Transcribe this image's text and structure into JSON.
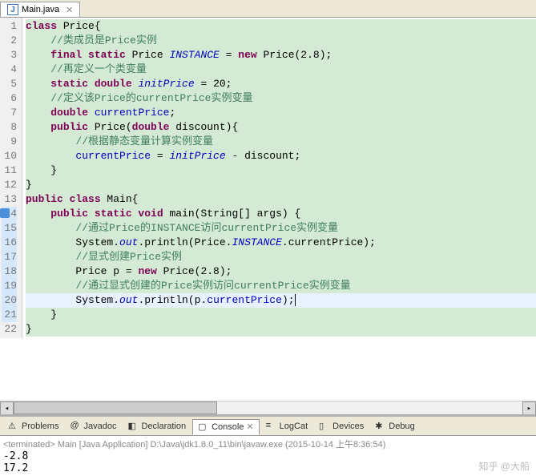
{
  "tab": {
    "title": "Main.java",
    "close": "✕"
  },
  "lines": [
    {
      "n": 1,
      "hl": false,
      "bg": "green",
      "tokens": [
        [
          "kw",
          "class"
        ],
        [
          "",
          " Price{"
        ]
      ]
    },
    {
      "n": 2,
      "hl": false,
      "bg": "green",
      "tokens": [
        [
          "",
          "    "
        ],
        [
          "cm",
          "//类成员是Price实例"
        ]
      ]
    },
    {
      "n": 3,
      "hl": false,
      "bg": "green",
      "tokens": [
        [
          "",
          "    "
        ],
        [
          "kw",
          "final static"
        ],
        [
          "",
          " Price "
        ],
        [
          "it",
          "INSTANCE"
        ],
        [
          "",
          " = "
        ],
        [
          "kw",
          "new"
        ],
        [
          "",
          " Price(2.8);"
        ]
      ]
    },
    {
      "n": 4,
      "hl": false,
      "bg": "green",
      "tokens": [
        [
          "",
          "    "
        ],
        [
          "cm",
          "//再定义一个类变量"
        ]
      ]
    },
    {
      "n": 5,
      "hl": false,
      "bg": "green",
      "tokens": [
        [
          "",
          "    "
        ],
        [
          "kw",
          "static double"
        ],
        [
          "",
          " "
        ],
        [
          "it",
          "initPrice"
        ],
        [
          "",
          " = 20;"
        ]
      ]
    },
    {
      "n": 6,
      "hl": false,
      "bg": "green",
      "tokens": [
        [
          "",
          "    "
        ],
        [
          "cm",
          "//定义该Price的currentPrice实例变量"
        ]
      ]
    },
    {
      "n": 7,
      "hl": false,
      "bg": "green",
      "tokens": [
        [
          "",
          "    "
        ],
        [
          "kw",
          "double"
        ],
        [
          "",
          " "
        ],
        [
          "fld",
          "currentPrice"
        ],
        [
          "",
          ";"
        ]
      ]
    },
    {
      "n": 8,
      "hl": false,
      "bg": "green",
      "tokens": [
        [
          "",
          "    "
        ],
        [
          "kw",
          "public"
        ],
        [
          "",
          " Price("
        ],
        [
          "kw",
          "double"
        ],
        [
          "",
          " discount){"
        ]
      ]
    },
    {
      "n": 9,
      "hl": false,
      "bg": "green",
      "tokens": [
        [
          "",
          "        "
        ],
        [
          "cm",
          "//根据静态变量计算实例变量"
        ]
      ]
    },
    {
      "n": 10,
      "hl": false,
      "bg": "green",
      "tokens": [
        [
          "",
          "        "
        ],
        [
          "fld",
          "currentPrice"
        ],
        [
          "",
          " = "
        ],
        [
          "it",
          "initPrice"
        ],
        [
          "",
          " - discount;"
        ]
      ]
    },
    {
      "n": 11,
      "hl": false,
      "bg": "green",
      "tokens": [
        [
          "",
          "    }"
        ]
      ]
    },
    {
      "n": 12,
      "hl": false,
      "bg": "green",
      "tokens": [
        [
          "",
          "}"
        ]
      ]
    },
    {
      "n": 13,
      "hl": false,
      "bg": "green",
      "tokens": [
        [
          "kw",
          "public class"
        ],
        [
          "",
          " Main{"
        ]
      ]
    },
    {
      "n": 14,
      "hl": true,
      "bg": "green",
      "tokens": [
        [
          "",
          "    "
        ],
        [
          "kw",
          "public static void"
        ],
        [
          "",
          " main(String[] args) {"
        ]
      ]
    },
    {
      "n": 15,
      "hl": true,
      "bg": "green",
      "tokens": [
        [
          "",
          "        "
        ],
        [
          "cm",
          "//通过Price的INSTANCE访问currentPrice实例变量"
        ]
      ]
    },
    {
      "n": 16,
      "hl": true,
      "bg": "green",
      "tokens": [
        [
          "",
          "        System."
        ],
        [
          "it",
          "out"
        ],
        [
          "",
          ".println(Price."
        ],
        [
          "it",
          "INSTANCE"
        ],
        [
          "",
          ".currentPrice);"
        ]
      ]
    },
    {
      "n": 17,
      "hl": true,
      "bg": "green",
      "tokens": [
        [
          "",
          "        "
        ],
        [
          "cm",
          "//显式创建Price实例"
        ]
      ]
    },
    {
      "n": 18,
      "hl": true,
      "bg": "green",
      "tokens": [
        [
          "",
          "        Price p = "
        ],
        [
          "kw",
          "new"
        ],
        [
          "",
          " Price(2.8);"
        ]
      ]
    },
    {
      "n": 19,
      "hl": true,
      "bg": "green",
      "tokens": [
        [
          "",
          "        "
        ],
        [
          "cm",
          "//通过显式创建的Price实例访问currentPrice实例变量"
        ]
      ]
    },
    {
      "n": 20,
      "hl": true,
      "bg": "cursor",
      "tokens": [
        [
          "",
          "        System."
        ],
        [
          "it",
          "out"
        ],
        [
          "",
          ".println(p."
        ],
        [
          "fld",
          "currentPrice"
        ],
        [
          "",
          ");"
        ]
      ],
      "cursor": true
    },
    {
      "n": 21,
      "hl": true,
      "bg": "green",
      "tokens": [
        [
          "",
          "    }"
        ]
      ]
    },
    {
      "n": 22,
      "hl": false,
      "bg": "green",
      "tokens": [
        [
          "",
          "}"
        ]
      ]
    }
  ],
  "bottomTabs": [
    {
      "label": "Problems",
      "active": false
    },
    {
      "label": "Javadoc",
      "active": false
    },
    {
      "label": "Declaration",
      "active": false
    },
    {
      "label": "Console",
      "active": true
    },
    {
      "label": "LogCat",
      "active": false
    },
    {
      "label": "Devices",
      "active": false
    },
    {
      "label": "Debug",
      "active": false
    }
  ],
  "console": {
    "header": "<terminated> Main [Java Application] D:\\Java\\jdk1.8.0_11\\bin\\javaw.exe (2015-10-14 上午8:36:54)",
    "lines": [
      "-2.8",
      "17.2"
    ]
  },
  "watermark": "知乎 @大船",
  "icons": {
    "problems": "⚠",
    "javadoc": "@",
    "declaration": "◧",
    "console": "▢",
    "logcat": "≡",
    "devices": "▯",
    "debug": "✱"
  }
}
